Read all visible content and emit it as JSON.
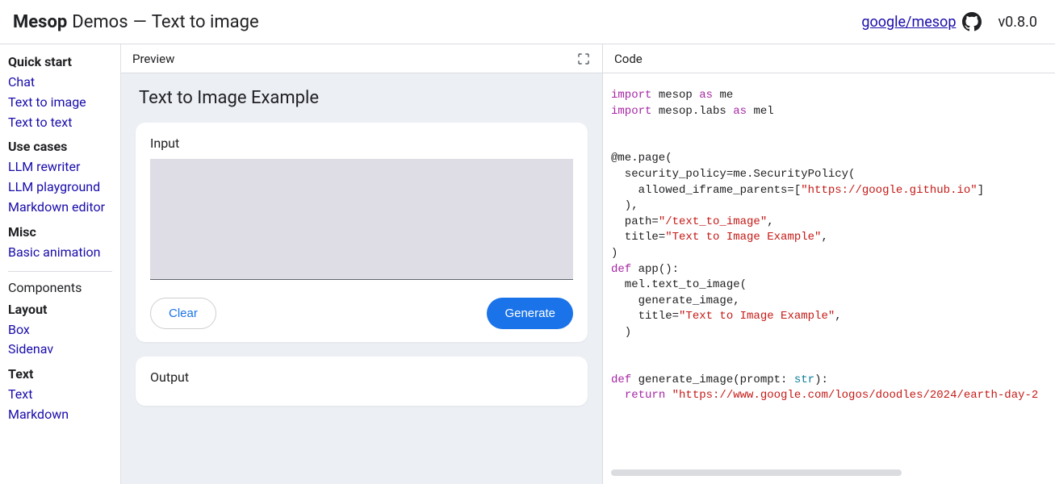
{
  "header": {
    "brand": "Mesop",
    "demos_label": "Demos",
    "separator": "—",
    "page_title": "Text to image",
    "repo_link_text": "google/mesop",
    "version": "v0.8.0"
  },
  "sidebar": {
    "sections": [
      {
        "title": "Quick start",
        "items": [
          "Chat",
          "Text to image",
          "Text to text"
        ]
      },
      {
        "title": "Use cases",
        "items": [
          "LLM rewriter",
          "LLM playground",
          "Markdown editor"
        ]
      },
      {
        "title": "Misc",
        "items": [
          "Basic animation"
        ]
      }
    ],
    "divider": true,
    "components_title": "Components",
    "component_sections": [
      {
        "title": "Layout",
        "items": [
          "Box",
          "Sidenav"
        ]
      },
      {
        "title": "Text",
        "items": [
          "Text",
          "Markdown"
        ]
      }
    ]
  },
  "preview": {
    "header_label": "Preview",
    "example_title": "Text to Image Example",
    "input_label": "Input",
    "input_value": "",
    "clear_button": "Clear",
    "generate_button": "Generate",
    "output_label": "Output"
  },
  "code": {
    "header_label": "Code",
    "tokens": [
      [
        {
          "t": "import ",
          "c": "kw"
        },
        {
          "t": "mesop "
        },
        {
          "t": "as ",
          "c": "kw"
        },
        {
          "t": "me"
        }
      ],
      [
        {
          "t": "import ",
          "c": "kw"
        },
        {
          "t": "mesop.labs "
        },
        {
          "t": "as ",
          "c": "kw"
        },
        {
          "t": "mel"
        }
      ],
      [],
      [],
      [
        {
          "t": "@me.page("
        }
      ],
      [
        {
          "t": "  security_policy=me.SecurityPolicy("
        }
      ],
      [
        {
          "t": "    allowed_iframe_parents=["
        },
        {
          "t": "\"https://google.github.io\"",
          "c": "str"
        },
        {
          "t": "]"
        }
      ],
      [
        {
          "t": "  ),"
        }
      ],
      [
        {
          "t": "  path="
        },
        {
          "t": "\"/text_to_image\"",
          "c": "str"
        },
        {
          "t": ","
        }
      ],
      [
        {
          "t": "  title="
        },
        {
          "t": "\"Text to Image Example\"",
          "c": "str"
        },
        {
          "t": ","
        }
      ],
      [
        {
          "t": ")"
        }
      ],
      [
        {
          "t": "def ",
          "c": "kw"
        },
        {
          "t": "app():"
        }
      ],
      [
        {
          "t": "  mel.text_to_image("
        }
      ],
      [
        {
          "t": "    generate_image,"
        }
      ],
      [
        {
          "t": "    title="
        },
        {
          "t": "\"Text to Image Example\"",
          "c": "str"
        },
        {
          "t": ","
        }
      ],
      [
        {
          "t": "  )"
        }
      ],
      [],
      [],
      [
        {
          "t": "def ",
          "c": "kw"
        },
        {
          "t": "generate_image(prompt: "
        },
        {
          "t": "str",
          "c": "builtin"
        },
        {
          "t": "):"
        }
      ],
      [
        {
          "t": "  "
        },
        {
          "t": "return ",
          "c": "kw"
        },
        {
          "t": "\"https://www.google.com/logos/doodles/2024/earth-day-2",
          "c": "str"
        }
      ]
    ]
  }
}
